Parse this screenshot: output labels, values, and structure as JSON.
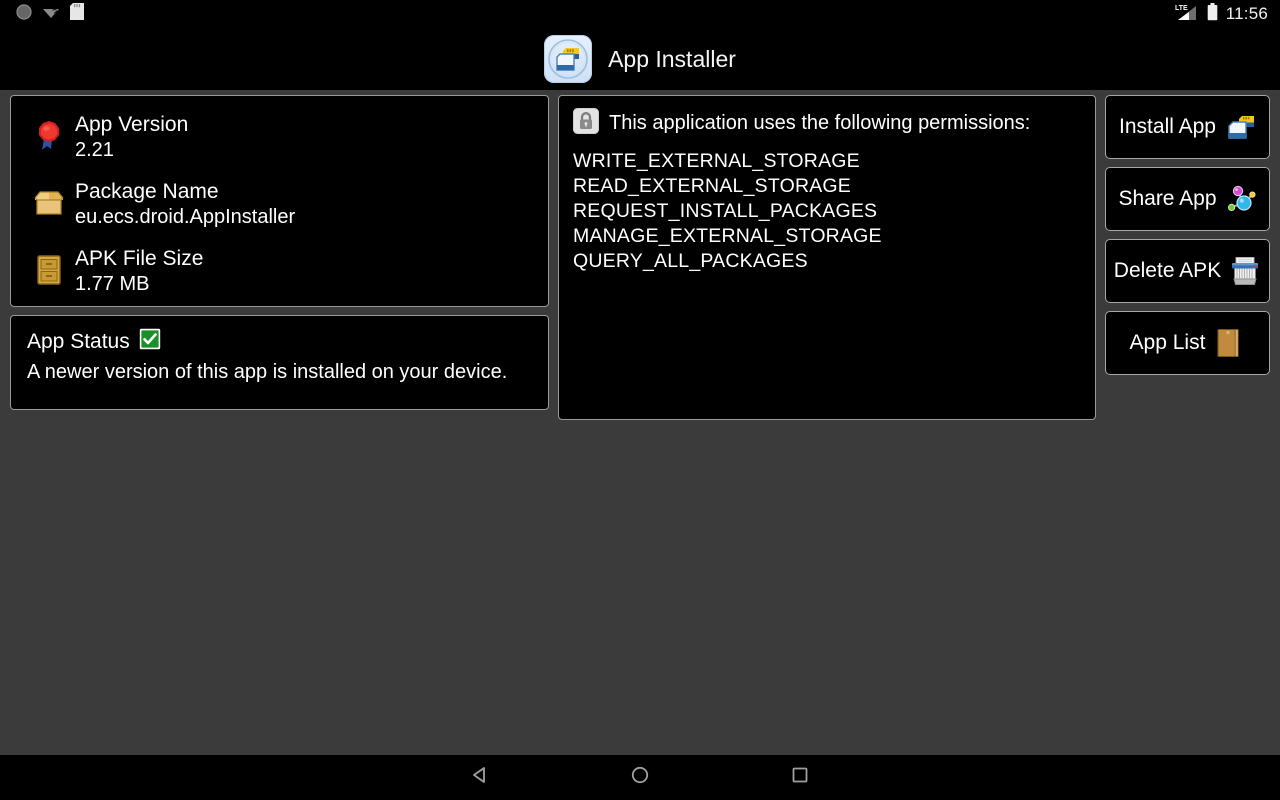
{
  "status_bar": {
    "left_icons": [
      "circle-placeholder-icon",
      "wifi-question-icon",
      "sd-card-icon"
    ],
    "network_label": "LTE",
    "right_icons": [
      "lte-signal-icon",
      "battery-icon"
    ],
    "clock": "11:56"
  },
  "header": {
    "icon": "app-installer-icon",
    "title": "App Installer"
  },
  "info": {
    "rows": [
      {
        "icon": "red-seal-icon",
        "label": "App Version",
        "value": "2.21"
      },
      {
        "icon": "open-box-icon",
        "label": "Package Name",
        "value": "eu.ecs.droid.AppInstaller"
      },
      {
        "icon": "file-cabinet-icon",
        "label": "APK File Size",
        "value": "1.77 MB"
      }
    ]
  },
  "app_status": {
    "title": "App Status",
    "icon": "green-check-icon",
    "message": "A newer version of this app is installed on your device."
  },
  "permissions": {
    "icon": "lock-icon",
    "heading": "This application uses the following permissions:",
    "items": [
      "WRITE_EXTERNAL_STORAGE",
      "READ_EXTERNAL_STORAGE",
      "REQUEST_INSTALL_PACKAGES",
      "MANAGE_EXTERNAL_STORAGE",
      "QUERY_ALL_PACKAGES"
    ]
  },
  "actions": [
    {
      "label": "Install App",
      "icon": "sd-cards-icon"
    },
    {
      "label": "Share App",
      "icon": "share-nodes-icon"
    },
    {
      "label": "Delete APK",
      "icon": "paper-shredder-icon"
    },
    {
      "label": "App List",
      "icon": "notebook-icon"
    }
  ],
  "nav_bar": {
    "back": "back-triangle-icon",
    "home": "home-circle-icon",
    "recents": "recents-square-icon"
  },
  "colors": {
    "background": "#3b3b3b",
    "panel_bg": "#000000",
    "panel_border": "#9a9a9a",
    "text": "#ffffff",
    "status_ok": "#1a9128"
  }
}
